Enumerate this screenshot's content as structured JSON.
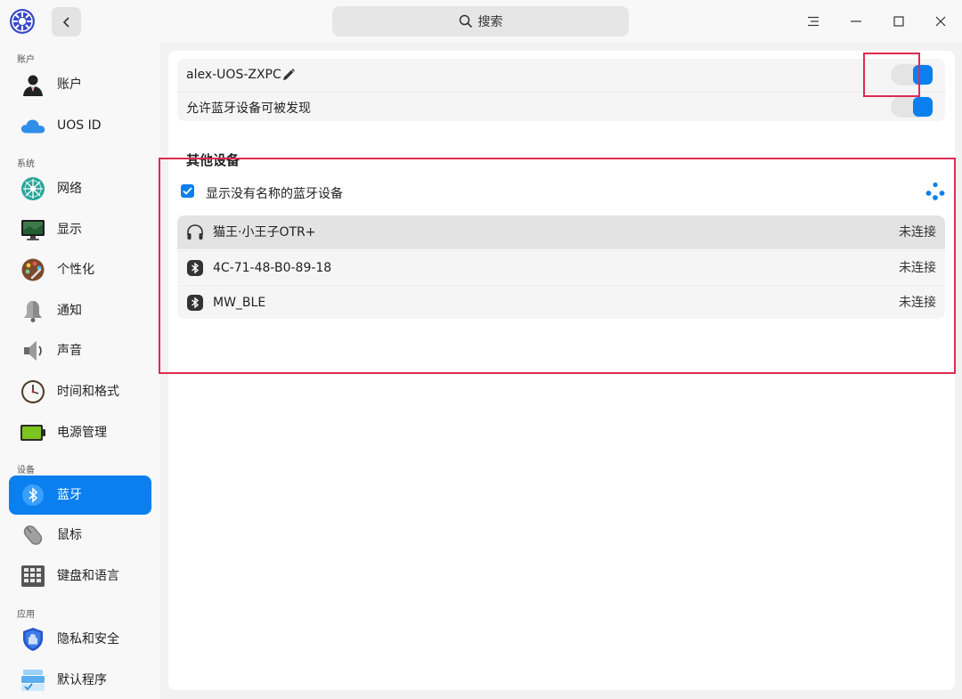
{
  "titlebar": {
    "search_label": "搜索",
    "icons": [
      "app-logo-icon",
      "chevron-left-icon",
      "search-icon",
      "menu-icon",
      "minimize-icon",
      "maximize-icon",
      "close-icon"
    ]
  },
  "sidebar": {
    "groups": [
      {
        "label": "账户"
      },
      {
        "label": "系统"
      },
      {
        "label": "设备"
      },
      {
        "label": "应用"
      }
    ],
    "items": [
      {
        "label": "账户",
        "icon": "user-icon"
      },
      {
        "label": "UOS ID",
        "icon": "cloud-icon"
      },
      {
        "label": "网络",
        "icon": "network-icon"
      },
      {
        "label": "显示",
        "icon": "display-icon"
      },
      {
        "label": "个性化",
        "icon": "palette-icon"
      },
      {
        "label": "通知",
        "icon": "bell-icon"
      },
      {
        "label": "声音",
        "icon": "speaker-icon"
      },
      {
        "label": "时间和格式",
        "icon": "clock-icon"
      },
      {
        "label": "电源管理",
        "icon": "battery-icon"
      },
      {
        "label": "蓝牙",
        "icon": "bluetooth-icon",
        "active": true
      },
      {
        "label": "鼠标",
        "icon": "mouse-icon"
      },
      {
        "label": "键盘和语言",
        "icon": "keyboard-icon"
      },
      {
        "label": "隐私和安全",
        "icon": "shield-icon"
      },
      {
        "label": "默认程序",
        "icon": "default-apps-icon"
      }
    ]
  },
  "bluetooth": {
    "device_name": "alex-UOS-ZXPC",
    "discoverable_label": "允许蓝牙设备可被发现",
    "power_on": true,
    "discoverable_on": true,
    "other_devices_title": "其他设备",
    "show_unnamed_label": "显示没有名称的蓝牙设备",
    "show_unnamed_checked": true,
    "devices": [
      {
        "name": "猫王·小王子OTR+",
        "status": "未连接",
        "icon": "headphones-icon"
      },
      {
        "name": "4C-71-48-B0-89-18",
        "status": "未连接",
        "icon": "bluetooth-icon"
      },
      {
        "name": "MW_BLE",
        "status": "未连接",
        "icon": "bluetooth-icon"
      }
    ]
  },
  "colors": {
    "accent": "#0a7ff0",
    "highlight": "#e02a52"
  }
}
